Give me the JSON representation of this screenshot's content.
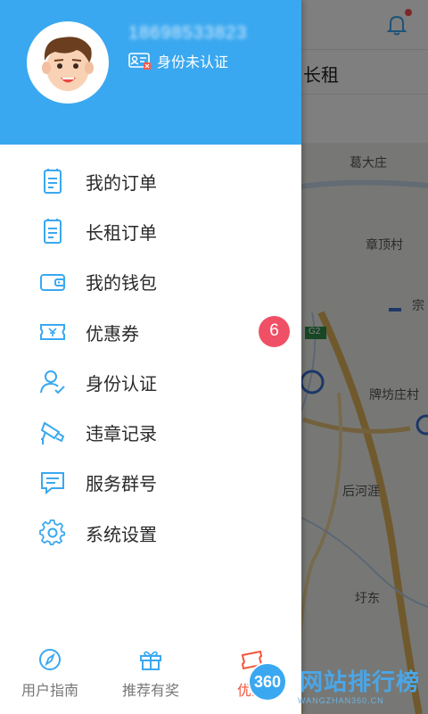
{
  "user": {
    "phone": "18698533823",
    "verify_status": "身份未认证"
  },
  "menu": {
    "items": [
      {
        "label": "我的订单",
        "icon": "order-list-icon"
      },
      {
        "label": "长租订单",
        "icon": "long-rent-order-icon"
      },
      {
        "label": "我的钱包",
        "icon": "wallet-icon"
      },
      {
        "label": "优惠券",
        "icon": "coupon-icon",
        "badge": "6"
      },
      {
        "label": "身份认证",
        "icon": "user-verify-icon"
      },
      {
        "label": "违章记录",
        "icon": "camera-violation-icon"
      },
      {
        "label": "服务群号",
        "icon": "chat-group-icon"
      },
      {
        "label": "系统设置",
        "icon": "gear-icon"
      }
    ]
  },
  "bottom_bar": {
    "items": [
      {
        "label": "用户指南",
        "icon": "compass-icon"
      },
      {
        "label": "推荐有奖",
        "icon": "gift-icon"
      },
      {
        "label": "优惠",
        "icon": "coupon-ticket-icon",
        "active": true
      }
    ]
  },
  "background": {
    "tab_label": "长租",
    "map_labels": [
      "葛大庄",
      "章顶村",
      "宗",
      "G2",
      "牌坊庄村",
      "后河涯",
      "圩东"
    ]
  },
  "watermark": {
    "logo": "360",
    "text": "网站排行榜",
    "sub": "WANGZHAN360.CN"
  },
  "colors": {
    "primary": "#3aa8f0",
    "badge": "#f05066",
    "active": "#f2553a"
  }
}
